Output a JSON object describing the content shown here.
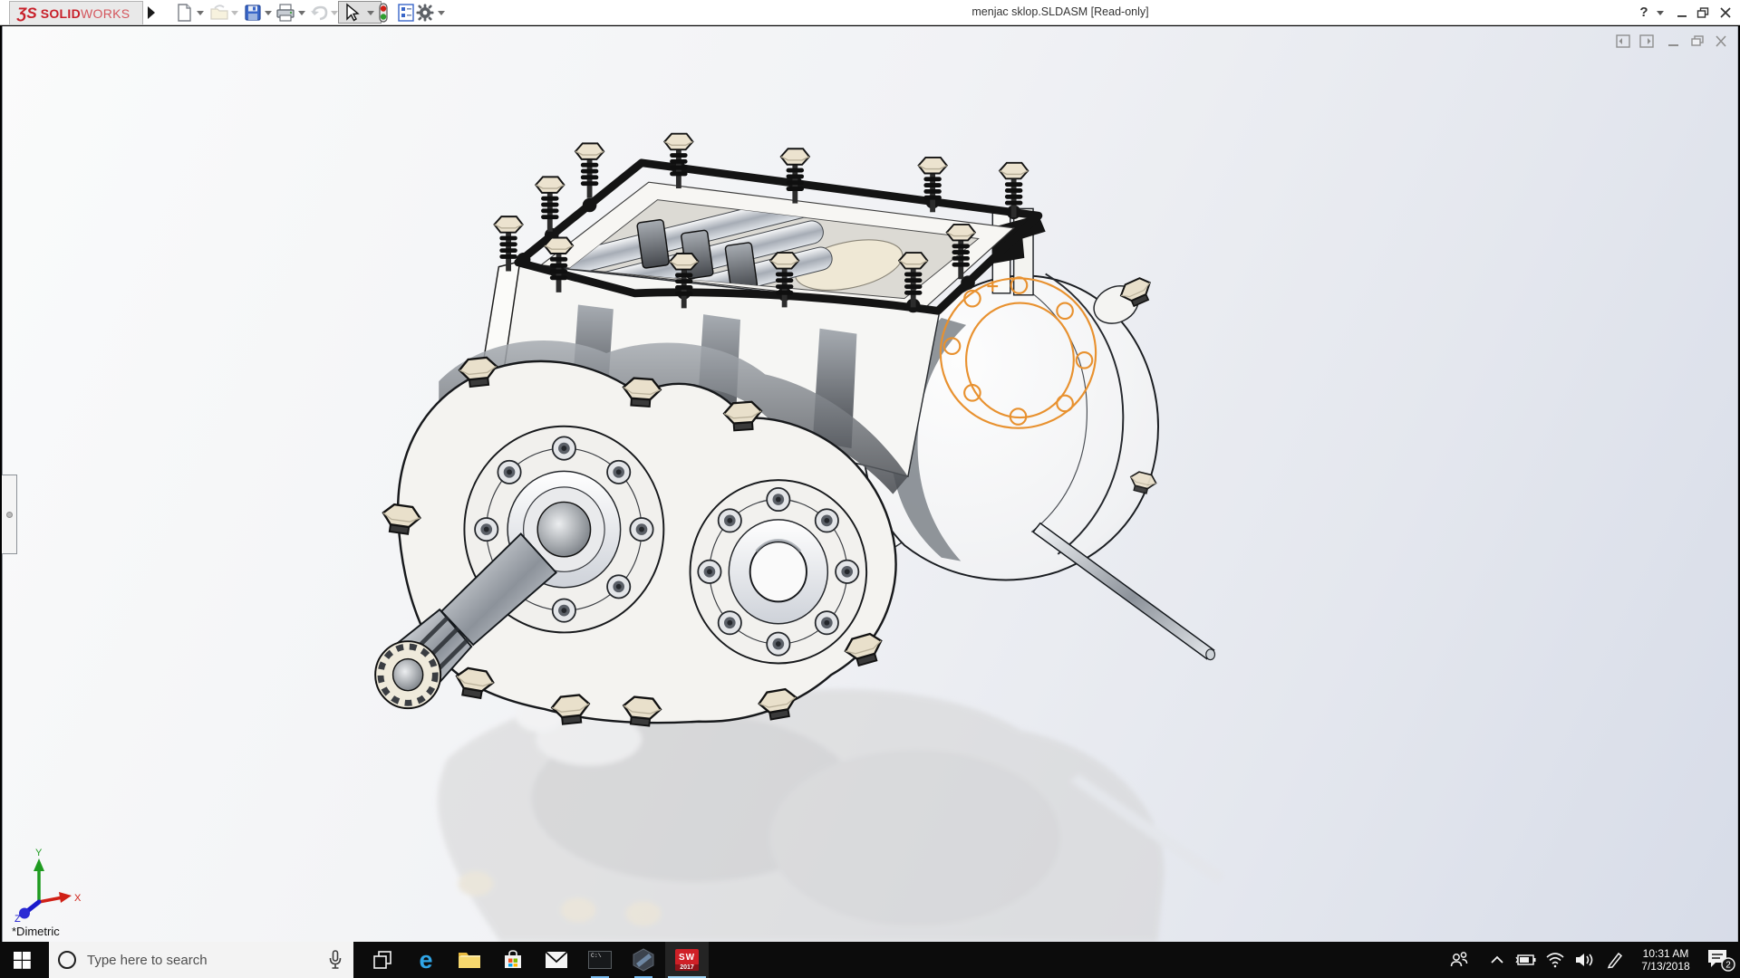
{
  "window": {
    "title": "menjac sklop.SLDASM [Read-only]",
    "brand": {
      "glyph": "ƷS",
      "bold": "SOLID",
      "light": "WORKS",
      "color": "#c8202a"
    },
    "toolbar_icons": [
      "flyout-expand",
      "new-document",
      "open",
      "save",
      "print",
      "undo",
      "select",
      "interference-check",
      "report",
      "options"
    ],
    "controls": {
      "help_glyph": "?",
      "buttons": [
        "help",
        "minimize",
        "restore",
        "close"
      ]
    }
  },
  "document_window": {
    "controls": [
      "previous-pane",
      "next-pane",
      "minimize",
      "restore",
      "close"
    ]
  },
  "viewport": {
    "view_label": "*Dimetric",
    "triad": {
      "x": "X",
      "y": "Y",
      "z": "Z"
    },
    "sketch_color": "#e8912f",
    "model": "gearbox-assembly"
  },
  "taskbar": {
    "background": "#0c0c0c",
    "accent_underline": "#76b9ed",
    "search": {
      "placeholder": "Type here to search"
    },
    "apps": [
      "task-view",
      "microsoft-edge",
      "file-explorer",
      "microsoft-store",
      "mail",
      "command-prompt",
      "edrawings",
      "solidworks-2017"
    ],
    "edge_glyph": "e",
    "cmd_prompt": "C:\\",
    "solidworks_badge": {
      "text": "SW",
      "year": "2017"
    },
    "tray": {
      "icons": [
        "people",
        "hidden-icons-chevron",
        "battery",
        "wifi",
        "volume",
        "pen",
        "action-center"
      ],
      "time": "10:31 AM",
      "date": "7/13/2018",
      "notification_count": "2"
    }
  }
}
